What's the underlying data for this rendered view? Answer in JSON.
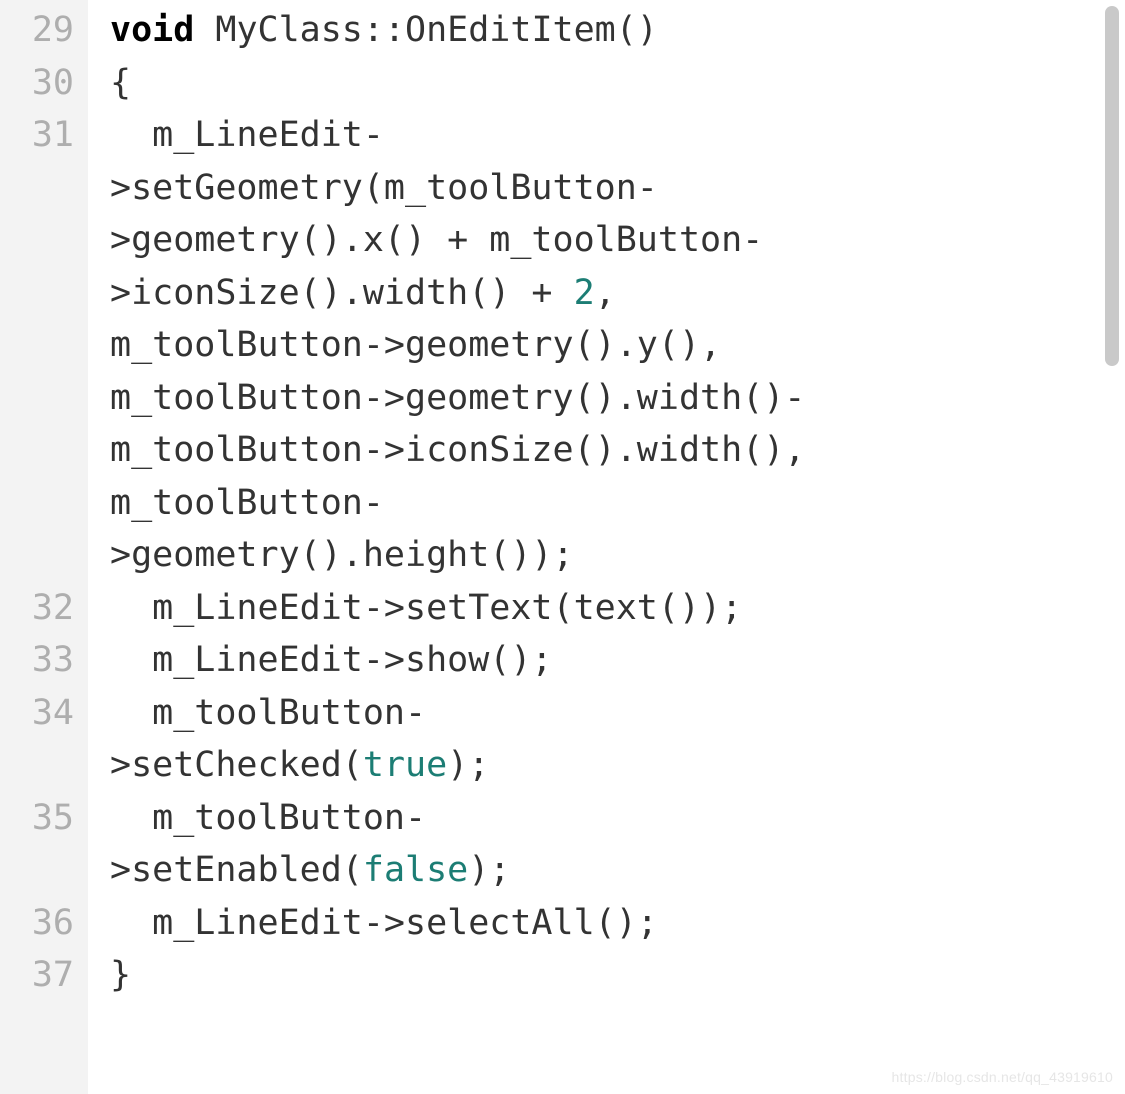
{
  "watermark": "https://blog.csdn.net/qq_43919610",
  "lines": [
    {
      "num": "29",
      "segs": [
        {
          "t": "void",
          "c": "kw"
        },
        {
          "t": " MyClass::OnEditItem()"
        }
      ]
    },
    {
      "num": "30",
      "segs": [
        {
          "t": "{"
        }
      ]
    },
    {
      "num": "31",
      "indent": 1,
      "segs": [
        {
          "t": "m_LineEdit-"
        }
      ]
    },
    {
      "cont": true,
      "segs": [
        {
          "t": ">setGeometry(m_toolButton-"
        }
      ]
    },
    {
      "cont": true,
      "segs": [
        {
          "t": ">geometry().x() + m_toolButton-"
        }
      ]
    },
    {
      "cont": true,
      "segs": [
        {
          "t": ">iconSize().width() + "
        },
        {
          "t": "2",
          "c": "num"
        },
        {
          "t": ", "
        }
      ]
    },
    {
      "cont": true,
      "segs": [
        {
          "t": "m_toolButton->geometry().y(), "
        }
      ]
    },
    {
      "cont": true,
      "segs": [
        {
          "t": "m_toolButton->geometry().width()- "
        }
      ]
    },
    {
      "cont": true,
      "segs": [
        {
          "t": "m_toolButton->iconSize().width(), "
        }
      ]
    },
    {
      "cont": true,
      "segs": [
        {
          "t": "m_toolButton-"
        }
      ]
    },
    {
      "cont": true,
      "segs": [
        {
          "t": ">geometry().height());"
        }
      ]
    },
    {
      "num": "32",
      "indent": 1,
      "segs": [
        {
          "t": "m_LineEdit->setText(text());"
        }
      ]
    },
    {
      "num": "33",
      "indent": 1,
      "segs": [
        {
          "t": "m_LineEdit->show();"
        }
      ]
    },
    {
      "num": "34",
      "indent": 1,
      "segs": [
        {
          "t": "m_toolButton-"
        }
      ]
    },
    {
      "cont": true,
      "segs": [
        {
          "t": ">setChecked("
        },
        {
          "t": "true",
          "c": "boolkw"
        },
        {
          "t": ");"
        }
      ]
    },
    {
      "num": "35",
      "indent": 1,
      "segs": [
        {
          "t": "m_toolButton-"
        }
      ]
    },
    {
      "cont": true,
      "segs": [
        {
          "t": ">setEnabled("
        },
        {
          "t": "false",
          "c": "boolkw"
        },
        {
          "t": ");"
        }
      ]
    },
    {
      "num": "36",
      "indent": 1,
      "segs": [
        {
          "t": "m_LineEdit->selectAll();"
        }
      ]
    },
    {
      "num": "37",
      "segs": [
        {
          "t": "}"
        }
      ]
    }
  ]
}
